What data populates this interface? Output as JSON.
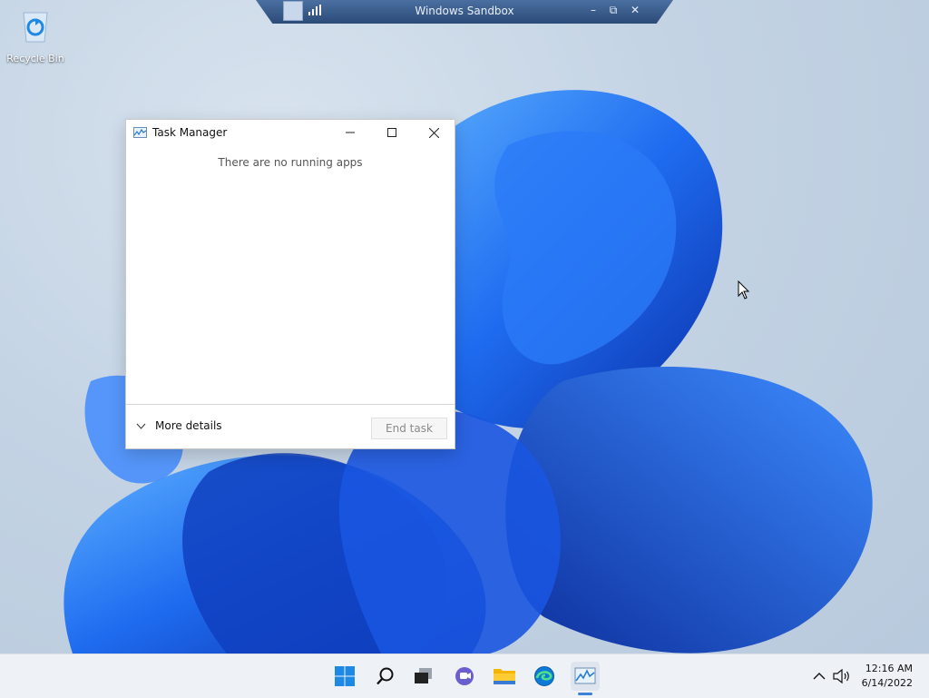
{
  "desktop": {
    "recycle_bin_label": "Recycle Bin"
  },
  "sandbox_bar": {
    "title": "Windows Sandbox",
    "minimize": "–",
    "restore": "⧉",
    "close": "✕"
  },
  "task_manager": {
    "title": "Task Manager",
    "empty_message": "There are no running apps",
    "more_details_label": "More details",
    "end_task_label": "End task"
  },
  "taskbar": {
    "items": [
      {
        "name": "start",
        "icon": "windows-logo-icon"
      },
      {
        "name": "search",
        "icon": "search-icon"
      },
      {
        "name": "task-view",
        "icon": "task-view-icon"
      },
      {
        "name": "chat",
        "icon": "chat-icon"
      },
      {
        "name": "file-explorer",
        "icon": "folder-icon"
      },
      {
        "name": "edge",
        "icon": "edge-icon"
      },
      {
        "name": "task-manager",
        "icon": "task-manager-icon",
        "active": true
      }
    ],
    "clock_time": "12:16 AM",
    "clock_date": "6/14/2022"
  },
  "colors": {
    "accent": "#3b82d8",
    "wallpaper_blue": "#1d5fe0",
    "sandbox_bar": "#2b4b78"
  }
}
